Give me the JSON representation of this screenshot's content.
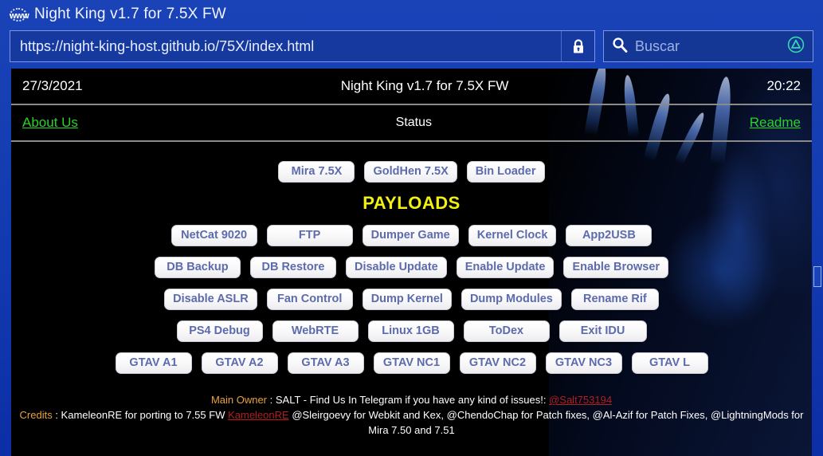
{
  "browser": {
    "window_title": "Night King v1.7 for 7.5X FW",
    "www_icon": "www-globe-icon",
    "url": "https://night-king-host.github.io/75X/index.html",
    "lock_icon": "padlock-icon",
    "search_placeholder": "Buscar",
    "search_icon": "search-icon",
    "triangle_button_icon": "ps-triangle-icon"
  },
  "page": {
    "date": "27/3/2021",
    "title": "Night King v1.7 for 7.5X FW",
    "time": "20:22",
    "about_us": "About Us",
    "status": "Status",
    "readme": "Readme",
    "payloads_heading": "PAYLOADS",
    "top_row": [
      "Mira 7.5X",
      "GoldHen 7.5X",
      "Bin Loader"
    ],
    "rows": [
      [
        "NetCat 9020",
        "FTP",
        "Dumper Game",
        "Kernel Clock",
        "App2USB"
      ],
      [
        "DB Backup",
        "DB Restore",
        "Disable Update",
        "Enable Update",
        "Enable Browser"
      ],
      [
        "Disable ASLR",
        "Fan Control",
        "Dump Kernel",
        "Dump Modules",
        "Rename Rif"
      ],
      [
        "PS4 Debug",
        "WebRTE",
        "Linux 1GB",
        "ToDex",
        "Exit IDU"
      ],
      [
        "GTAV A1",
        "GTAV A2",
        "GTAV A3",
        "GTAV NC1",
        "GTAV NC2",
        "GTAV NC3",
        "GTAV L"
      ]
    ],
    "footer": {
      "owner_label": "Main Owner",
      "owner_text": " : SALT - Find Us In Telegram if you have any kind of issues!: ",
      "owner_link": "@Salt753194",
      "credits_label": "Credits",
      "credits_text_1": " : KameleonRE for porting to 7.55 FW ",
      "credits_link": "KameleonRE",
      "credits_text_2": " @Sleirgoevy for Webkit and Kex, @ChendoChap for Patch fixes, @Al-Azif for Patch Fixes, @LightningMods for Mira 7.50 and 7.51"
    }
  },
  "colors": {
    "chrome_blue": "#123ab0",
    "link_green": "#27d327",
    "payload_yellow": "#f1f110",
    "button_text": "#5c6bad",
    "label_orange": "#e8a33d",
    "link_red": "#b21f1f"
  }
}
